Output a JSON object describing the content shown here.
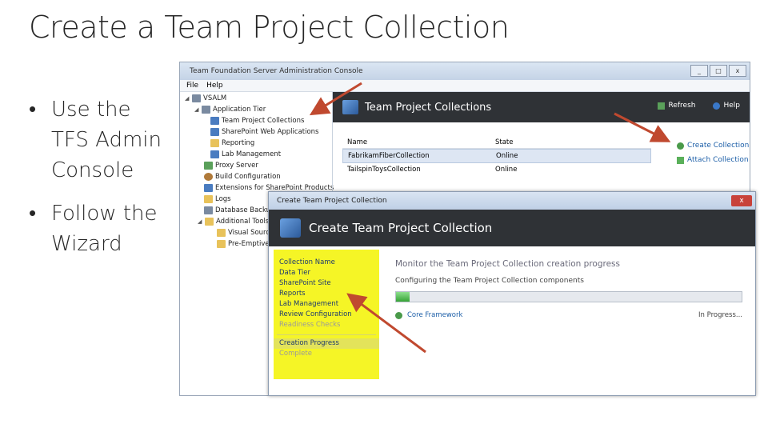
{
  "slide": {
    "title": "Create a Team Project Collection",
    "bullets": [
      "Use the TFS Admin Console",
      "Follow the Wizard"
    ]
  },
  "console": {
    "window_title": "Team Foundation Server Administration Console",
    "window_buttons": [
      "_",
      "□",
      "x"
    ],
    "menu": [
      "File",
      "Help"
    ],
    "tree": [
      {
        "label": "VSALM",
        "icon": "server-icon"
      },
      {
        "label": "Application Tier",
        "icon": "server-icon"
      },
      {
        "label": "Team Project Collections",
        "icon": "collection-icon"
      },
      {
        "label": "SharePoint Web Applications",
        "icon": "sharepoint-icon"
      },
      {
        "label": "Reporting",
        "icon": "report-icon"
      },
      {
        "label": "Lab Management",
        "icon": "lab-icon"
      },
      {
        "label": "Proxy Server",
        "icon": "proxy-icon"
      },
      {
        "label": "Build Configuration",
        "icon": "build-icon"
      },
      {
        "label": "Extensions for SharePoint Products",
        "icon": "extension-icon"
      },
      {
        "label": "Logs",
        "icon": "log-icon"
      },
      {
        "label": "Database Backups",
        "icon": "database-icon"
      },
      {
        "label": "Additional Tools",
        "icon": "tools-icon"
      },
      {
        "label": "Visual Source",
        "icon": "tool-icon"
      },
      {
        "label": "Pre-Emptive A",
        "icon": "tool-icon"
      }
    ],
    "pane_title": "Team Project Collections",
    "header_links": {
      "refresh": "Refresh",
      "help": "Help"
    },
    "table": {
      "columns": [
        "Name",
        "State"
      ],
      "rows": [
        {
          "name": "FabrikamFiberCollection",
          "state": "Online"
        },
        {
          "name": "TailspinToysCollection",
          "state": "Online"
        }
      ]
    },
    "actions": {
      "create": "Create Collection",
      "attach": "Attach Collection"
    }
  },
  "dialog": {
    "window_title": "Create Team Project Collection",
    "close_label": "x",
    "header": "Create Team Project Collection",
    "steps": [
      "Collection Name",
      "Data Tier",
      "SharePoint Site",
      "Reports",
      "Lab Management",
      "Review Configuration",
      "Readiness Checks"
    ],
    "steps_after": [
      "Creation Progress",
      "Complete"
    ],
    "progress_heading": "Monitor the Team Project Collection creation progress",
    "progress_status": "Configuring the Team Project Collection components",
    "progress_fraction": 0.04,
    "task": {
      "name": "Core Framework",
      "status": "In Progress..."
    }
  },
  "colors": {
    "arrow": "#c0492f",
    "highlight": "#f5f526",
    "header_dark": "#2f3236"
  }
}
